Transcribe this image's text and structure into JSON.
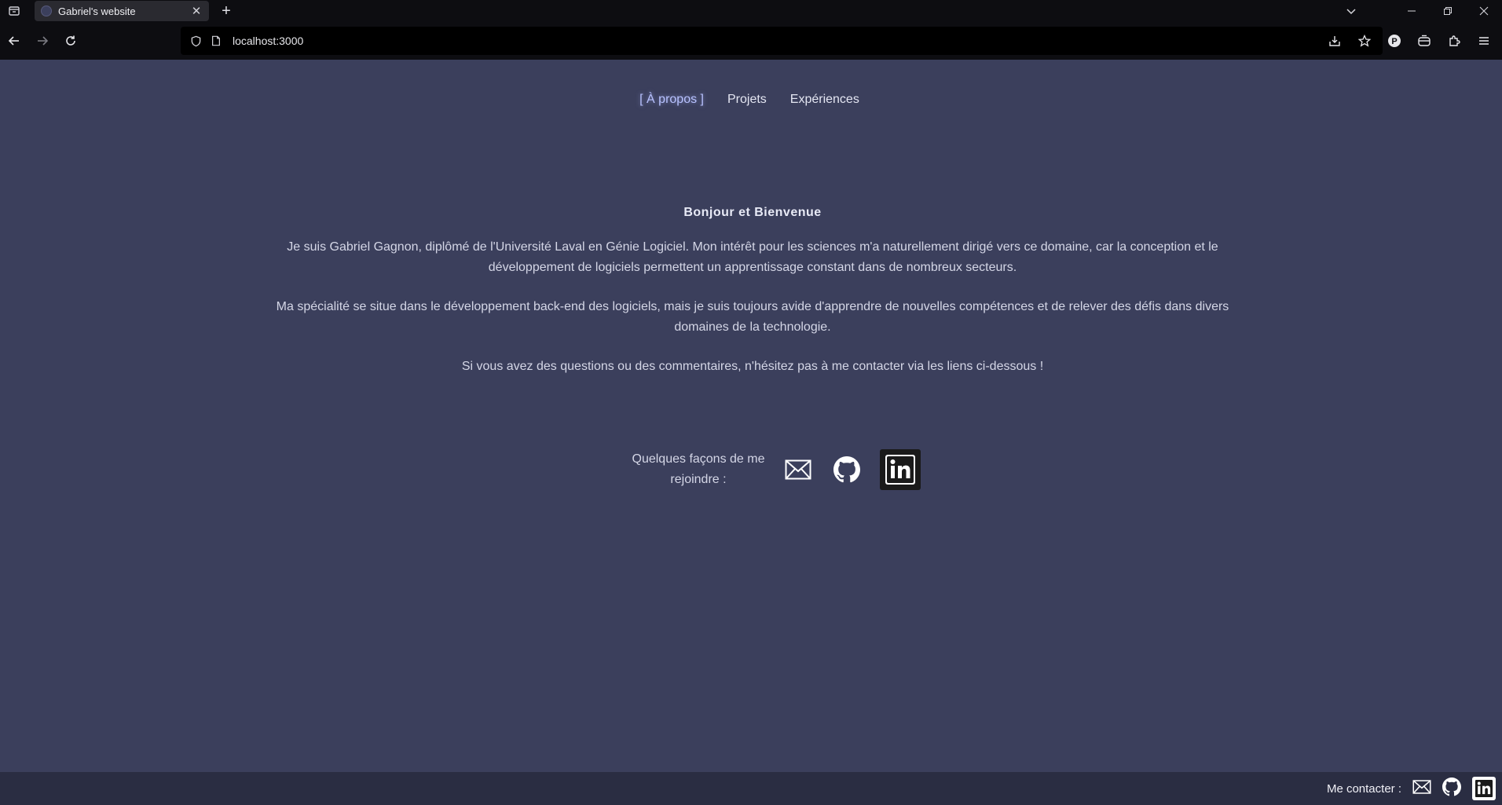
{
  "browser": {
    "tab_title": "Gabriel's website",
    "url": "localhost:3000"
  },
  "site_nav": {
    "items": [
      {
        "label": "[ À propos ]",
        "active": true
      },
      {
        "label": "Projets",
        "active": false
      },
      {
        "label": "Expériences",
        "active": false
      }
    ]
  },
  "main": {
    "heading": "Bonjour et Bienvenue",
    "paragraphs": [
      "Je suis Gabriel Gagnon, diplômé de l'Université Laval en Génie Logiciel. Mon intérêt pour les sciences m'a naturellement dirigé vers ce domaine, car la conception et le développement de logiciels permettent un apprentissage constant dans de nombreux secteurs.",
      "Ma spécialité se situe dans le développement back-end des logiciels, mais je suis toujours avide d'apprendre de nouvelles compétences et de relever des défis dans divers domaines de la technologie.",
      "Si vous avez des questions ou des commentaires, n'hésitez pas à me contacter via les liens ci-dessous !"
    ],
    "reach_label": "Quelques façons de me rejoindre :",
    "reach_icons": [
      "mail-icon",
      "github-icon",
      "linkedin-icon"
    ]
  },
  "footer": {
    "label": "Me contacter :",
    "icons": [
      "mail-icon",
      "github-icon",
      "linkedin-icon"
    ]
  },
  "colors": {
    "page_bg": "#3b3f5c",
    "footer_bg": "#2a2d42",
    "active_nav": "#b8c2ff"
  }
}
